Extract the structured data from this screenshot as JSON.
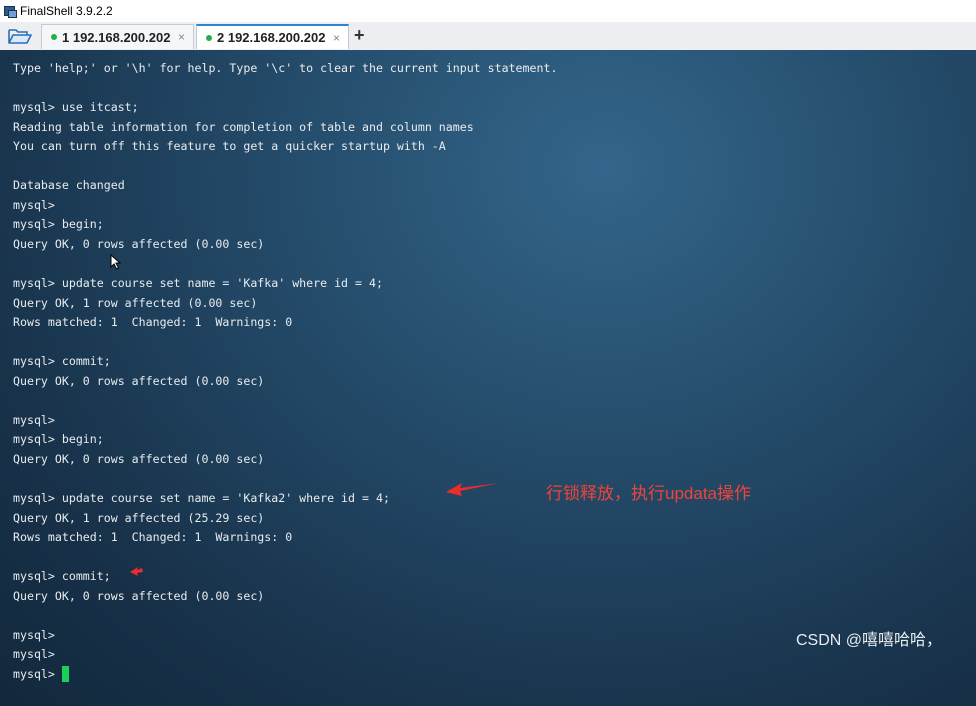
{
  "window": {
    "title": "FinalShell 3.9.2.2"
  },
  "tabs": [
    {
      "label": "1 192.168.200.202",
      "active": false
    },
    {
      "label": "2 192.168.200.202",
      "active": true
    }
  ],
  "tab_close_glyph": "×",
  "add_tab_glyph": "+",
  "terminal": {
    "lines": [
      "Type 'help;' or '\\h' for help. Type '\\c' to clear the current input statement.",
      "",
      "mysql> use itcast;",
      "Reading table information for completion of table and column names",
      "You can turn off this feature to get a quicker startup with -A",
      "",
      "Database changed",
      "mysql>",
      "mysql> begin;",
      "Query OK, 0 rows affected (0.00 sec)",
      "",
      "mysql> update course set name = 'Kafka' where id = 4;",
      "Query OK, 1 row affected (0.00 sec)",
      "Rows matched: 1  Changed: 1  Warnings: 0",
      "",
      "mysql> commit;",
      "Query OK, 0 rows affected (0.00 sec)",
      "",
      "mysql>",
      "mysql> begin;",
      "Query OK, 0 rows affected (0.00 sec)",
      "",
      "mysql> update course set name = 'Kafka2' where id = 4;",
      "Query OK, 1 row affected (25.29 sec)",
      "Rows matched: 1  Changed: 1  Warnings: 0",
      "",
      "mysql> commit;",
      "Query OK, 0 rows affected (0.00 sec)",
      "",
      "mysql>",
      "mysql>",
      "mysql>"
    ]
  },
  "annotation": {
    "text": "行锁释放，执行updata操作",
    "color": "#f0443a"
  },
  "watermark": "CSDN @嘻嘻哈哈，",
  "colors": {
    "terminal_bg": "#1b3248",
    "cursor": "#18d05a",
    "tab_accent": "#2a86d6",
    "status_dot": "#23b04a"
  }
}
